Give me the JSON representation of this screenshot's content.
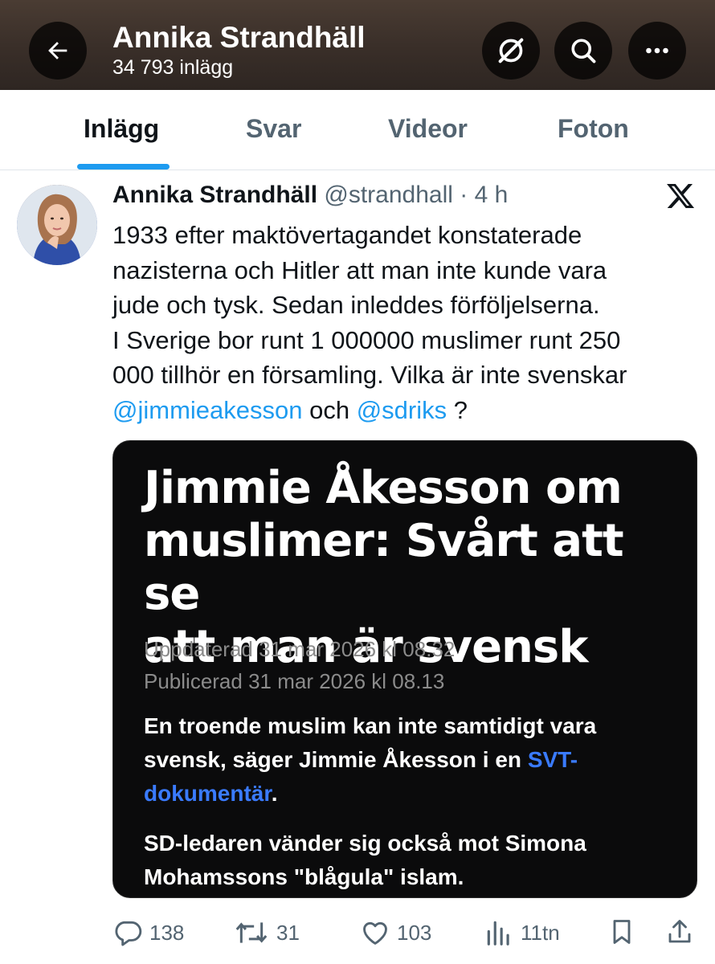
{
  "header": {
    "title": "Annika Strandhäll",
    "subtitle": "34 793 inlägg"
  },
  "tabs": [
    {
      "label": "Inlägg"
    },
    {
      "label": "Svar"
    },
    {
      "label": "Videor"
    },
    {
      "label": "Foton"
    }
  ],
  "post": {
    "author_name": "Annika Strandhäll",
    "handle": "@strandhall",
    "time": " · 4 h",
    "text_lines": [
      "1933 efter maktövertagandet konstaterade",
      "nazisterna och Hitler att man inte kunde vara",
      "jude och tysk. Sedan inleddes förföljelserna.",
      "I Sverige bor runt 1 000000 muslimer runt 250",
      "000 tillhör en församling. Vilka är inte svenskar"
    ],
    "mention1": "@jimmieakesson",
    "joiner": " och ",
    "mention2": "@sdriks",
    "trailing": " ?"
  },
  "media": {
    "headline_lines": [
      "Jimmie Åkesson om",
      "muslimer: Svårt att se",
      "att man är svensk"
    ],
    "updated": "Uppdaterad 31 mar 2026 kl 08.32",
    "published": "Publicerad 31 mar 2026 kl 08.13",
    "para1_text": "En troende muslim kan inte samtidigt vara svensk, säger Jimmie Åkesson i en ",
    "para1_link": "SVT-dokumentär",
    "para1_end": ".",
    "para2": "SD-ledaren vänder sig också mot Simona Mohamssons \"blågula\" islam."
  },
  "actions": {
    "replies": "138",
    "reposts": "31",
    "likes": "103",
    "views": "11tn"
  },
  "colors": {
    "accent": "#1d9bf0",
    "secondary_text": "#536471",
    "media_link": "#3a7bff"
  },
  "icons": [
    "back-arrow-icon",
    "grok-icon",
    "search-icon",
    "more-icon",
    "x-logo-icon",
    "reply-icon",
    "repost-icon",
    "like-icon",
    "views-icon",
    "bookmark-icon",
    "share-icon"
  ]
}
